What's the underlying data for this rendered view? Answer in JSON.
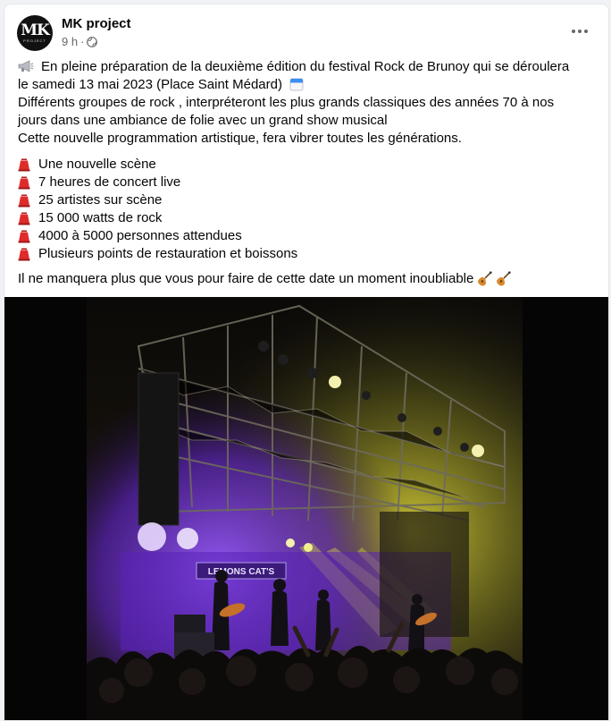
{
  "post": {
    "author": "MK project",
    "avatar_text": "MK",
    "avatar_subtext": "PROJECT",
    "time": "9 h",
    "separator": "·",
    "privacy_icon": "globe-icon",
    "more_icon": "more-options-icon",
    "lines": {
      "l1": "En pleine préparation de la deuxième édition du festival Rock de Brunoy qui se déroulera",
      "l2": "le samedi 13 mai 2023 (Place Saint Médard)",
      "l3": "Différents groupes de rock , interpréteront les plus grands classiques des années 70 à nos",
      "l4": "jours dans une ambiance de folie avec un grand  show musical",
      "l5": "Cette nouvelle programmation artistique, fera vibrer toutes les générations."
    },
    "list": [
      "Une nouvelle scène",
      "7 heures de concert live",
      "25 artistes sur scène",
      "15 000 watts de rock",
      "4000 à 5000 personnes attendues",
      "Plusieurs points de restauration et boissons"
    ],
    "list_icon": "red-lantern-icon",
    "closing": "Il ne manquera plus que vous pour faire de cette date un moment inoubliable",
    "closing_icons": [
      "guitar-icon",
      "guitar-icon"
    ]
  },
  "photo": {
    "banner_text": "LEMONS CAT'S",
    "colors": {
      "stage_purple": "#6b2fd0",
      "stage_yellow": "#e6e23a",
      "truss": "#3a3a3c"
    }
  }
}
